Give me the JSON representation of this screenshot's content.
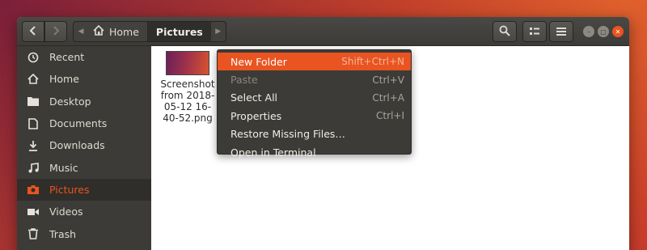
{
  "header": {
    "back_icon": "chevron-left-icon",
    "forward_icon": "chevron-right-icon",
    "breadcrumb": {
      "home": "Home",
      "current": "Pictures"
    },
    "buttons": [
      "search-icon",
      "view-toggle-icon",
      "hamburger-menu-icon"
    ]
  },
  "sidebar": {
    "items": [
      {
        "label": "Recent",
        "icon": "clock-icon"
      },
      {
        "label": "Home",
        "icon": "home-icon"
      },
      {
        "label": "Desktop",
        "icon": "folder-icon"
      },
      {
        "label": "Documents",
        "icon": "document-icon"
      },
      {
        "label": "Downloads",
        "icon": "download-icon"
      },
      {
        "label": "Music",
        "icon": "music-icon"
      },
      {
        "label": "Pictures",
        "icon": "camera-icon"
      },
      {
        "label": "Videos",
        "icon": "video-icon"
      },
      {
        "label": "Trash",
        "icon": "trash-icon"
      }
    ]
  },
  "files": [
    {
      "name": "Screenshot from 2018-05-12 16-40-52.png"
    }
  ],
  "context_menu": {
    "items": [
      {
        "label": "New Folder",
        "accel": "Shift+Ctrl+N"
      },
      {
        "label": "Paste",
        "accel": "Ctrl+V"
      },
      {
        "label": "Select All",
        "accel": "Ctrl+A"
      },
      {
        "label": "Properties",
        "accel": "Ctrl+I"
      },
      {
        "label": "Restore Missing Files…",
        "accel": ""
      },
      {
        "label": "Open in Terminal",
        "accel": ""
      }
    ]
  },
  "colors": {
    "accent": "#e95420",
    "sidebar_bg": "#3d3b37"
  }
}
